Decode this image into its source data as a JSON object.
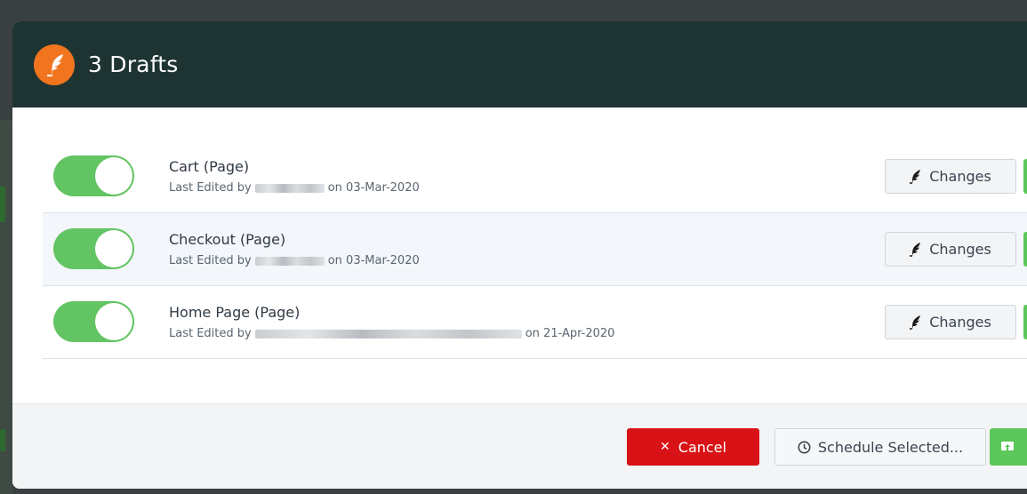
{
  "dialog": {
    "title": "3 Drafts",
    "logo_icon": "feather-icon"
  },
  "drafts": [
    {
      "title": "Cart (Page)",
      "meta_prefix": "Last Edited by",
      "meta_suffix": "on 03-Mar-2020",
      "enabled": true,
      "changes_label": "Changes"
    },
    {
      "title": "Checkout (Page)",
      "meta_prefix": "Last Edited by",
      "meta_suffix": "on 03-Mar-2020",
      "enabled": true,
      "changes_label": "Changes"
    },
    {
      "title": "Home Page (Page)",
      "meta_prefix": "Last Edited by",
      "meta_suffix": "on 21-Apr-2020",
      "enabled": true,
      "changes_label": "Changes"
    }
  ],
  "footer": {
    "cancel_label": "Cancel",
    "schedule_label": "Schedule Selected...",
    "publish_icon": "publish-icon"
  },
  "colors": {
    "header_bg": "#1e3433",
    "logo_bg": "#f0751e",
    "toggle_on": "#62c462",
    "cancel_bg": "#d81216",
    "publish_bg": "#5cc75a"
  }
}
